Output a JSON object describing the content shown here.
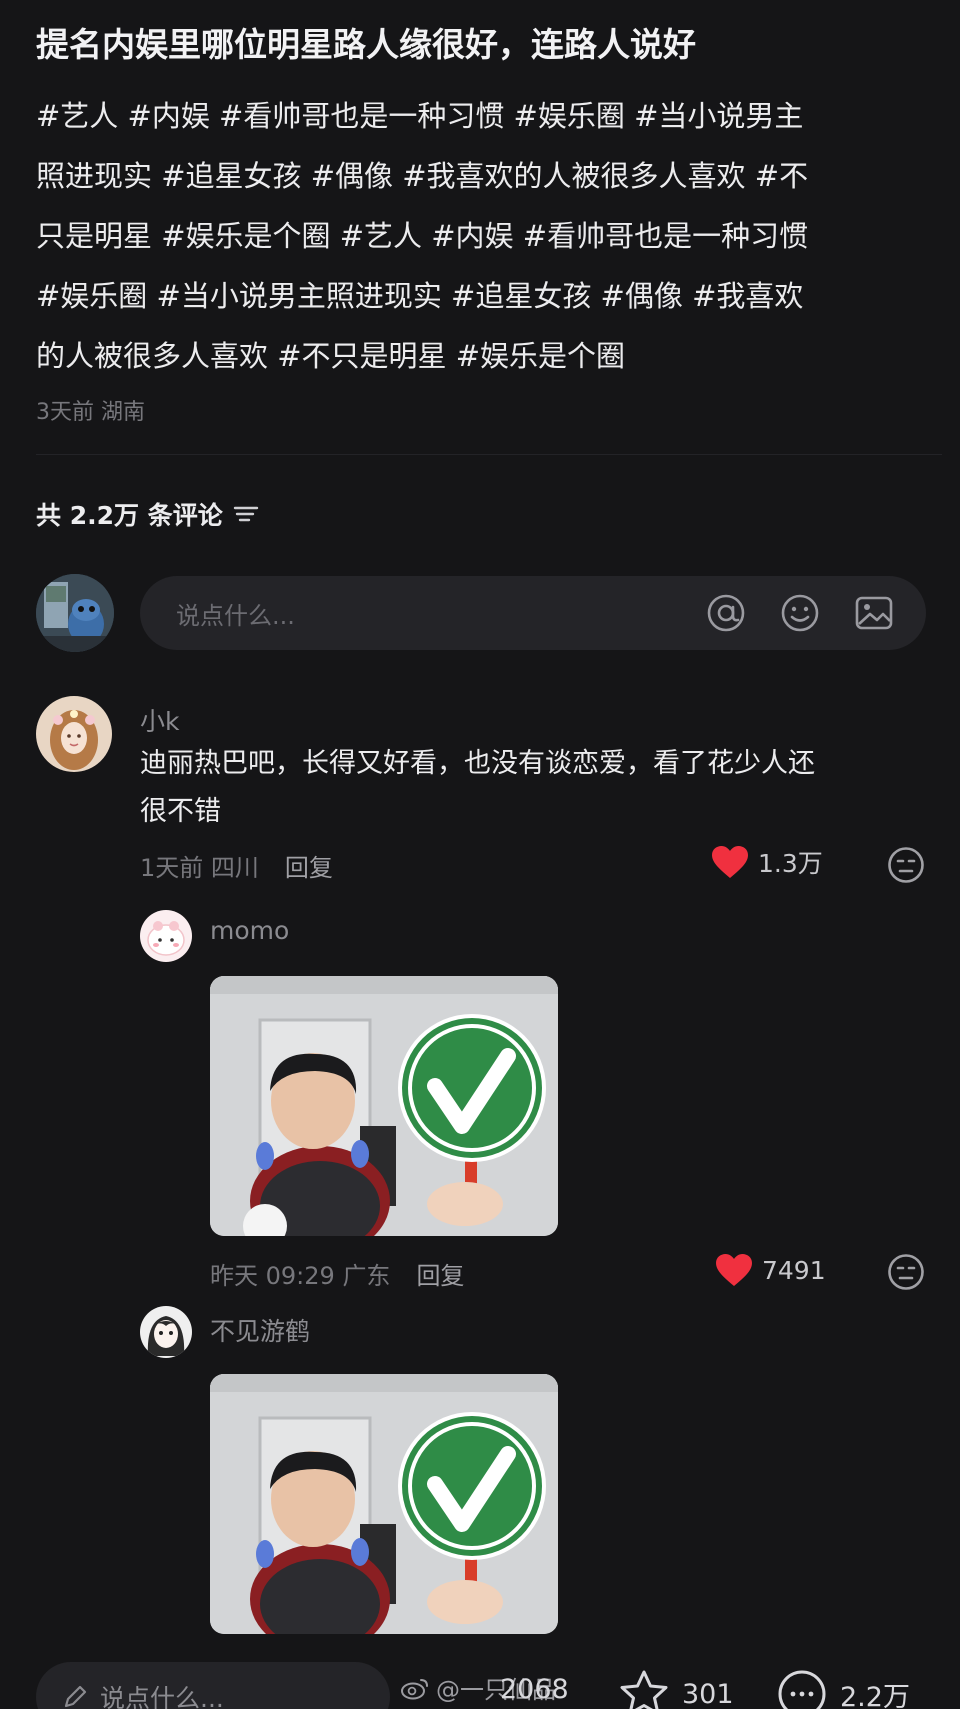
{
  "post": {
    "title": "提名内娱里哪位明星路人缘很好，连路人说好",
    "tags_line1": "#艺人 #内娱 #看帅哥也是一种习惯 #娱乐圈 #当小说男主",
    "tags_line2": "照进现实 #追星女孩 #偶像 #我喜欢的人被很多人喜欢 #不",
    "tags_line3": "只是明星 #娱乐是个圈 #艺人 #内娱 #看帅哥也是一种习惯",
    "tags_line4": "#娱乐圈 #当小说男主照进现实 #追星女孩 #偶像 #我喜欢",
    "tags_line5": "的人被很多人喜欢 #不只是明星 #娱乐是个圈",
    "time": "3天前",
    "location": "湖南"
  },
  "comments_header": {
    "count_label": "共 2.2万 条评论"
  },
  "comment_input": {
    "placeholder": "说点什么..."
  },
  "comments": [
    {
      "username": "小k",
      "text_line1": "迪丽热巴吧，长得又好看，也没有谈恋爱，看了花少人还",
      "text_line2": "很不错",
      "time": "1天前",
      "location": "四川",
      "reply_label": "回复",
      "likes": "1.3万"
    }
  ],
  "replies": [
    {
      "username": "momo",
      "time": "昨天 09:29",
      "location": "广东",
      "reply_label": "回复",
      "likes": "7491"
    },
    {
      "username": "不见游鹤"
    }
  ],
  "bottom_bar": {
    "input_placeholder": "说点什么...",
    "likes": "2068",
    "favorites": "301",
    "comments": "2.2万",
    "watermark": "@一只仙品"
  },
  "colors": {
    "background": "#151517",
    "heart": "#f0303f",
    "input_bg": "#242428"
  }
}
